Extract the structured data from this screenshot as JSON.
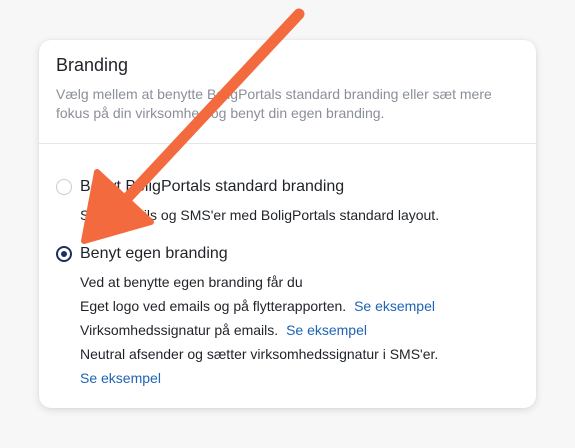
{
  "card": {
    "title": "Branding",
    "description": "Vælg mellem at benytte BoligPortals standard branding eller sæt mere fokus på din virksomhed og benyt din egen branding."
  },
  "options": {
    "standard": {
      "label": "Benyt BoligPortals standard branding",
      "description": "Send emails og SMS'er med BoligPortals standard layout.",
      "selected": false
    },
    "custom": {
      "label": "Benyt egen branding",
      "selected": true,
      "line1": "Ved at benytte egen branding får du",
      "line2_text": "Eget logo ved emails og på flytterapporten.",
      "line2_link": "Se eksempel",
      "line3_text": "Virksomhedssignatur på emails.",
      "line3_link": "Se eksempel",
      "line4_text": "Neutral afsender og sætter virksomhedssignatur i SMS'er.",
      "line4_link": "Se eksempel"
    }
  },
  "annotation": {
    "arrow_color": "#f26a3d",
    "icon": "arrow-annotation-icon"
  },
  "colors": {
    "radio_selected": "#1a2f66",
    "link": "#1e63b4",
    "muted_text": "#8a8f98"
  }
}
